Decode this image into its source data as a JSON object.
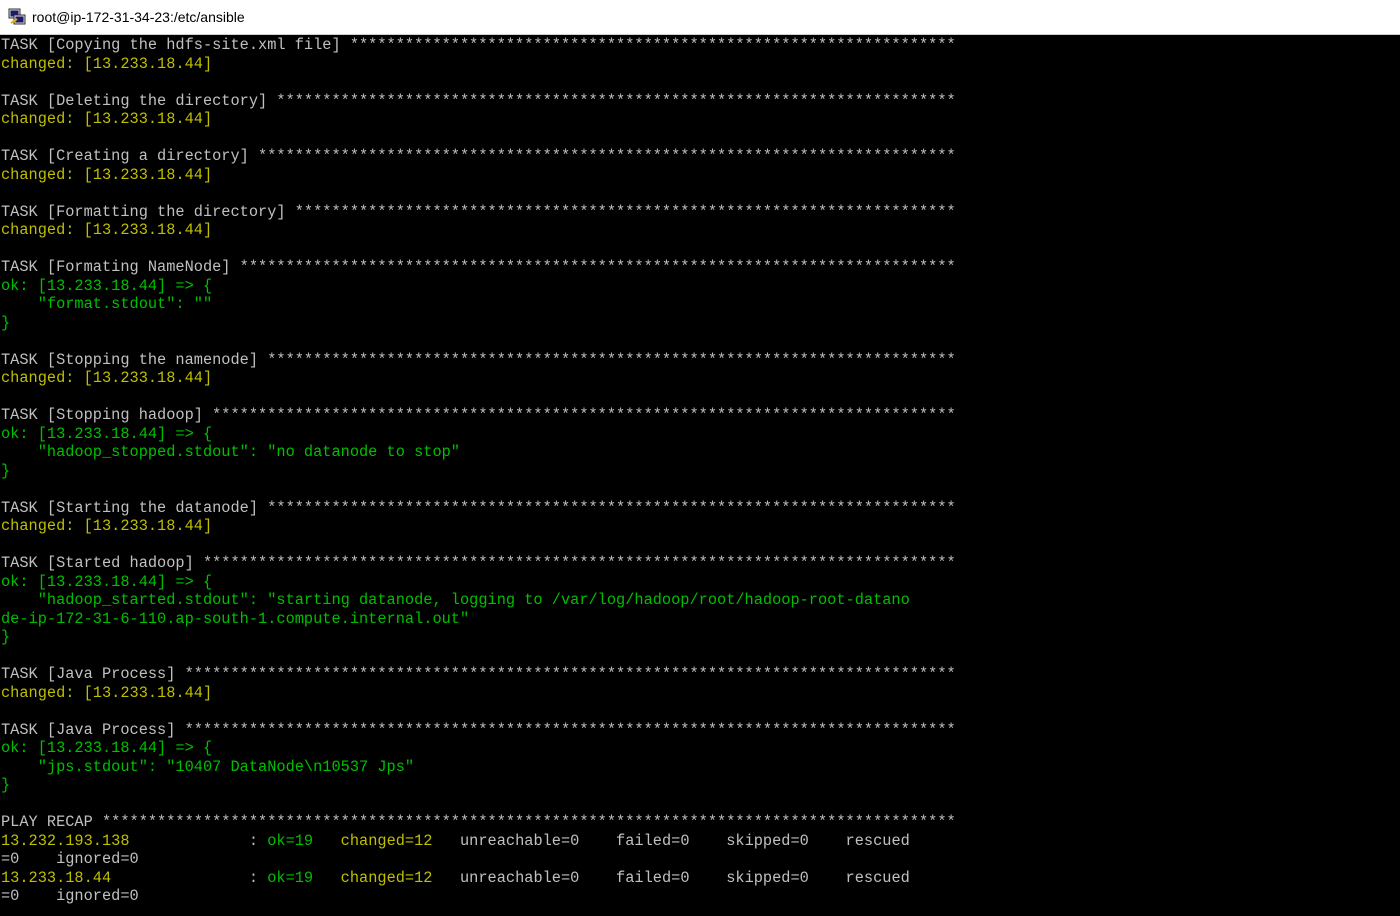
{
  "window": {
    "title": "root@ip-172-31-34-23:/etc/ansible",
    "icon": "putty-terminal-icon"
  },
  "colors": {
    "background": "#000000",
    "text": "#c0c0c0",
    "changed": "#bfbf00",
    "ok": "#00bf00",
    "titlebar": "#ffffff"
  },
  "lines": [
    {
      "segments": [
        {
          "t": "TASK [Copying the hdfs-site.xml file] ******************************************************************",
          "c": "white"
        }
      ]
    },
    {
      "segments": [
        {
          "t": "changed: [13.233.18.44]",
          "c": "yellow"
        }
      ]
    },
    {
      "segments": [
        {
          "t": "",
          "c": "white"
        }
      ]
    },
    {
      "segments": [
        {
          "t": "TASK [Deleting the directory] **************************************************************************",
          "c": "white"
        }
      ]
    },
    {
      "segments": [
        {
          "t": "changed: [13.233.18.44]",
          "c": "yellow"
        }
      ]
    },
    {
      "segments": [
        {
          "t": "",
          "c": "white"
        }
      ]
    },
    {
      "segments": [
        {
          "t": "TASK [Creating a directory] ****************************************************************************",
          "c": "white"
        }
      ]
    },
    {
      "segments": [
        {
          "t": "changed: [13.233.18.44]",
          "c": "yellow"
        }
      ]
    },
    {
      "segments": [
        {
          "t": "",
          "c": "white"
        }
      ]
    },
    {
      "segments": [
        {
          "t": "TASK [Formatting the directory] ************************************************************************",
          "c": "white"
        }
      ]
    },
    {
      "segments": [
        {
          "t": "changed: [13.233.18.44]",
          "c": "yellow"
        }
      ]
    },
    {
      "segments": [
        {
          "t": "",
          "c": "white"
        }
      ]
    },
    {
      "segments": [
        {
          "t": "TASK [Formating NameNode] ******************************************************************************",
          "c": "white"
        }
      ]
    },
    {
      "segments": [
        {
          "t": "ok: [13.233.18.44] => {",
          "c": "green"
        }
      ]
    },
    {
      "segments": [
        {
          "t": "    \"format.stdout\": \"\"",
          "c": "green"
        }
      ]
    },
    {
      "segments": [
        {
          "t": "}",
          "c": "green"
        }
      ]
    },
    {
      "segments": [
        {
          "t": "",
          "c": "white"
        }
      ]
    },
    {
      "segments": [
        {
          "t": "TASK [Stopping the namenode] ***************************************************************************",
          "c": "white"
        }
      ]
    },
    {
      "segments": [
        {
          "t": "changed: [13.233.18.44]",
          "c": "yellow"
        }
      ]
    },
    {
      "segments": [
        {
          "t": "",
          "c": "white"
        }
      ]
    },
    {
      "segments": [
        {
          "t": "TASK [Stopping hadoop] *********************************************************************************",
          "c": "white"
        }
      ]
    },
    {
      "segments": [
        {
          "t": "ok: [13.233.18.44] => {",
          "c": "green"
        }
      ]
    },
    {
      "segments": [
        {
          "t": "    \"hadoop_stopped.stdout\": \"no datanode to stop\"",
          "c": "green"
        }
      ]
    },
    {
      "segments": [
        {
          "t": "}",
          "c": "green"
        }
      ]
    },
    {
      "segments": [
        {
          "t": "",
          "c": "white"
        }
      ]
    },
    {
      "segments": [
        {
          "t": "TASK [Starting the datanode] ***************************************************************************",
          "c": "white"
        }
      ]
    },
    {
      "segments": [
        {
          "t": "changed: [13.233.18.44]",
          "c": "yellow"
        }
      ]
    },
    {
      "segments": [
        {
          "t": "",
          "c": "white"
        }
      ]
    },
    {
      "segments": [
        {
          "t": "TASK [Started hadoop] **********************************************************************************",
          "c": "white"
        }
      ]
    },
    {
      "segments": [
        {
          "t": "ok: [13.233.18.44] => {",
          "c": "green"
        }
      ]
    },
    {
      "segments": [
        {
          "t": "    \"hadoop_started.stdout\": \"starting datanode, logging to /var/log/hadoop/root/hadoop-root-datano",
          "c": "green"
        }
      ]
    },
    {
      "segments": [
        {
          "t": "de-ip-172-31-6-110.ap-south-1.compute.internal.out\"",
          "c": "green"
        }
      ]
    },
    {
      "segments": [
        {
          "t": "}",
          "c": "green"
        }
      ]
    },
    {
      "segments": [
        {
          "t": "",
          "c": "white"
        }
      ]
    },
    {
      "segments": [
        {
          "t": "TASK [Java Process] ************************************************************************************",
          "c": "white"
        }
      ]
    },
    {
      "segments": [
        {
          "t": "changed: [13.233.18.44]",
          "c": "yellow"
        }
      ]
    },
    {
      "segments": [
        {
          "t": "",
          "c": "white"
        }
      ]
    },
    {
      "segments": [
        {
          "t": "TASK [Java Process] ************************************************************************************",
          "c": "white"
        }
      ]
    },
    {
      "segments": [
        {
          "t": "ok: [13.233.18.44] => {",
          "c": "green"
        }
      ]
    },
    {
      "segments": [
        {
          "t": "    \"jps.stdout\": \"10407 DataNode\\n10537 Jps\"",
          "c": "green"
        }
      ]
    },
    {
      "segments": [
        {
          "t": "}",
          "c": "green"
        }
      ]
    },
    {
      "segments": [
        {
          "t": "",
          "c": "white"
        }
      ]
    },
    {
      "segments": [
        {
          "t": "PLAY RECAP *********************************************************************************************",
          "c": "white"
        }
      ]
    },
    {
      "segments": [
        {
          "t": "13.232.193.138",
          "c": "yellow"
        },
        {
          "t": "             : ",
          "c": "white"
        },
        {
          "t": "ok=19",
          "c": "green"
        },
        {
          "t": "   ",
          "c": "white"
        },
        {
          "t": "changed=12",
          "c": "yellow"
        },
        {
          "t": "   unreachable=0    failed=0    skipped=0    rescued",
          "c": "white"
        }
      ]
    },
    {
      "segments": [
        {
          "t": "=0    ignored=0",
          "c": "white"
        }
      ]
    },
    {
      "segments": [
        {
          "t": "13.233.18.44",
          "c": "yellow"
        },
        {
          "t": "               : ",
          "c": "white"
        },
        {
          "t": "ok=19",
          "c": "green"
        },
        {
          "t": "   ",
          "c": "white"
        },
        {
          "t": "changed=12",
          "c": "yellow"
        },
        {
          "t": "   unreachable=0    failed=0    skipped=0    rescued",
          "c": "white"
        }
      ]
    },
    {
      "segments": [
        {
          "t": "=0    ignored=0",
          "c": "white"
        }
      ]
    }
  ]
}
